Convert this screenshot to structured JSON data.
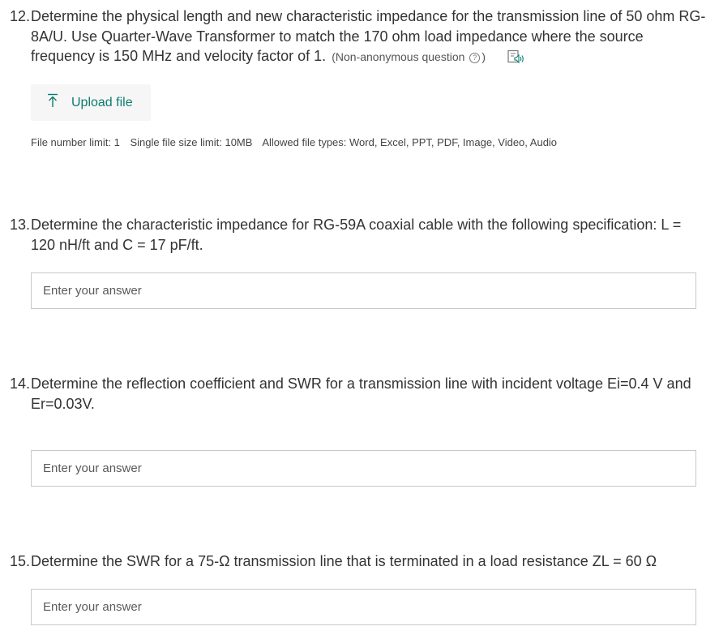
{
  "questions": [
    {
      "number": "12.",
      "text": "Determine the physical length and new characteristic impedance for the transmission line of 50 ohm RG-8A/U. Use Quarter-Wave Transformer to match the 170 ohm load impedance where the source frequency is 150 MHz and velocity factor of 1.",
      "note_prefix": "(Non-anonymous question",
      "note_suffix": ")",
      "upload_label": "Upload file",
      "file_limits": {
        "count": "File number limit: 1",
        "size": "Single file size limit: 10MB",
        "types": "Allowed file types: Word, Excel, PPT, PDF, Image, Video, Audio"
      }
    },
    {
      "number": "13.",
      "text": "Determine the characteristic impedance for RG-59A coaxial cable with the following specification: L = 120 nH/ft and C = 17 pF/ft.",
      "placeholder": "Enter your answer"
    },
    {
      "number": "14.",
      "line1": "Determine the reflection coefficient and SWR for a transmission line with incident voltage Ei=0.4 V and",
      "line2": "Er=0.03V.",
      "placeholder": "Enter your answer"
    },
    {
      "number": "15.",
      "text": "Determine the SWR for a 75-Ω transmission line that is terminated in a load resistance ZL = 60 Ω",
      "placeholder": "Enter your answer"
    }
  ],
  "icons": {
    "help": "question-circle-icon",
    "speaker": "immersive-reader-icon",
    "upload": "upload-arrow-icon"
  },
  "colors": {
    "accent": "#0a7d6f",
    "text": "#333333",
    "border": "#c8c8c8"
  }
}
